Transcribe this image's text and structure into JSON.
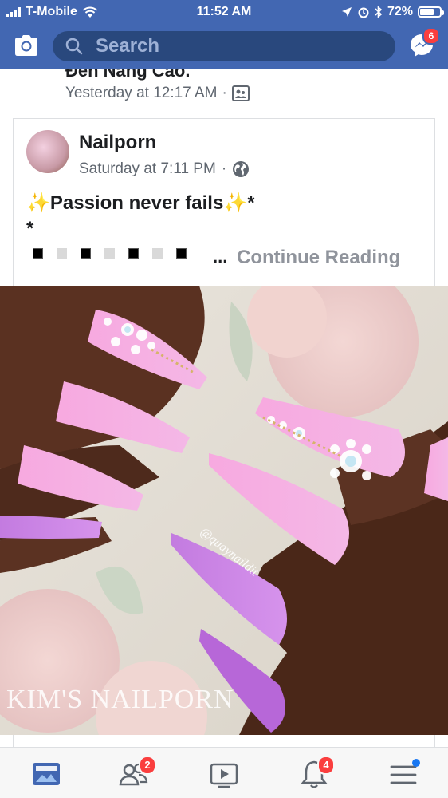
{
  "status_bar": {
    "carrier": "T-Mobile",
    "time": "11:52 AM",
    "battery": "72%",
    "battery_level": 0.72
  },
  "header": {
    "search_placeholder": "Search",
    "messenger_badge": "6"
  },
  "previous_post": {
    "title_partial": "Đến Nâng Cao.",
    "timestamp": "Yesterday at 12:17 AM"
  },
  "post": {
    "author": "Nailporn",
    "timestamp": "Saturday at 7:11 PM",
    "text_line1": "✨Passion never fails✨*",
    "text_line2": "*",
    "continue_label": "Continue Reading",
    "ellipsis": "...",
    "dots": [
      "dark",
      "light",
      "dark",
      "light",
      "dark",
      "light",
      "dark"
    ],
    "photo_watermark": "KIM'S NAILPORN",
    "photo_handle": "@quaynaildit"
  },
  "tab_bar": {
    "friends_badge": "2",
    "notifications_badge": "4"
  },
  "colors": {
    "brand": "#4267b2",
    "search_bg": "#29487d",
    "badge": "#fa3e3e",
    "secondary_text": "#606770"
  }
}
